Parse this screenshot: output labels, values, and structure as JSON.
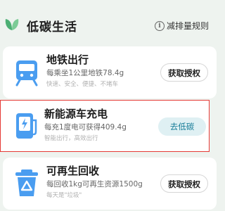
{
  "header": {
    "title": "低碳生活",
    "rules_link": "减排量规则",
    "leaf_icon": "leaf-icon",
    "info_icon": "info-icon",
    "colors": {
      "leaf": "#4caf74",
      "info": "#666666"
    }
  },
  "cards": [
    {
      "name": "地铁出行",
      "desc": "每乘坐1公里地铁78.4g",
      "tags": "快速、安全、便捷、不堵车",
      "button": "获取授权",
      "icon": "subway-icon"
    },
    {
      "name": "新能源车充电",
      "desc": "每充1度电可获得409.4g",
      "tags": "智能出行，高效出行",
      "button": "去低碳",
      "icon": "ev-charging-icon"
    },
    {
      "name": "可再生回收",
      "desc": "每回收1kg可再生资源1500g",
      "tags": "每天是\"垃圾\"",
      "button": "获取授权",
      "icon": "recycle-bin-icon"
    }
  ],
  "colors": {
    "icon_blue": "#4a9df0",
    "highlight_border": "#e53935",
    "active_button_bg": "#dff0f3",
    "active_button_text": "#1b7f9a"
  }
}
